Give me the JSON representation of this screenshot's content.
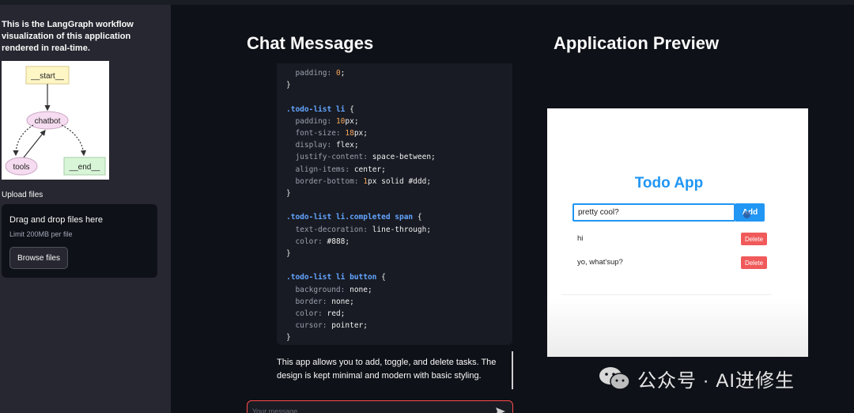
{
  "sidebar": {
    "description": "This is the LangGraph workflow visualization of this application rendered in real-time.",
    "graph": {
      "nodes": {
        "start": "__start__",
        "chatbot": "chatbot",
        "tools": "tools",
        "end": "__end__"
      }
    },
    "upload_label": "Upload files",
    "dropzone": {
      "title": "Drag and drop files here",
      "limit": "Limit 200MB per file",
      "browse_label": "Browse files"
    }
  },
  "chat": {
    "heading": "Chat Messages",
    "code_lines": [
      [
        "  ",
        "prop",
        "padding: ",
        "num",
        "0",
        "val",
        ";"
      ],
      [
        "}"
      ],
      [
        ""
      ],
      [
        "",
        "sel",
        ".todo-list li",
        "val",
        " {"
      ],
      [
        "  ",
        "prop",
        "padding: ",
        "num",
        "10",
        "val",
        "px;"
      ],
      [
        "  ",
        "prop",
        "font-size: ",
        "num",
        "18",
        "val",
        "px;"
      ],
      [
        "  ",
        "prop",
        "display: ",
        "val",
        "flex;"
      ],
      [
        "  ",
        "prop",
        "justify-content: ",
        "val",
        "space-between;"
      ],
      [
        "  ",
        "prop",
        "align-items: ",
        "val",
        "center;"
      ],
      [
        "  ",
        "prop",
        "border-bottom: ",
        "num",
        "1",
        "val",
        "px solid #ddd;"
      ],
      [
        "}"
      ],
      [
        ""
      ],
      [
        "",
        "sel",
        ".todo-list li.completed span",
        "val",
        " {"
      ],
      [
        "  ",
        "prop",
        "text-decoration: ",
        "val",
        "line-through;"
      ],
      [
        "  ",
        "prop",
        "color: ",
        "val",
        "#888;"
      ],
      [
        "}"
      ],
      [
        ""
      ],
      [
        "",
        "sel",
        ".todo-list li button",
        "val",
        " {"
      ],
      [
        "  ",
        "prop",
        "background: ",
        "val",
        "none;"
      ],
      [
        "  ",
        "prop",
        "border: ",
        "val",
        "none;"
      ],
      [
        "  ",
        "prop",
        "color: ",
        "val",
        "red;"
      ],
      [
        "  ",
        "prop",
        "cursor: ",
        "val",
        "pointer;"
      ],
      [
        "}"
      ]
    ],
    "message": "This app allows you to add, toggle, and delete tasks. The design is kept minimal and modern with basic styling.",
    "input_placeholder": "Your message"
  },
  "preview": {
    "heading": "Application Preview",
    "app_title": "Todo App",
    "input_value": "pretty cool?",
    "add_label": "Add",
    "todos": [
      {
        "text": "hi",
        "delete_label": "Delete"
      },
      {
        "text": "yo, what'sup?",
        "delete_label": "Delete"
      }
    ]
  },
  "watermark": {
    "text": "公众号 · AI进修生"
  },
  "colors": {
    "accent_blue": "#2196f3",
    "delete_red": "#f05a5a",
    "input_border": "#ff4b4b",
    "code_selector": "#63a4ff"
  }
}
